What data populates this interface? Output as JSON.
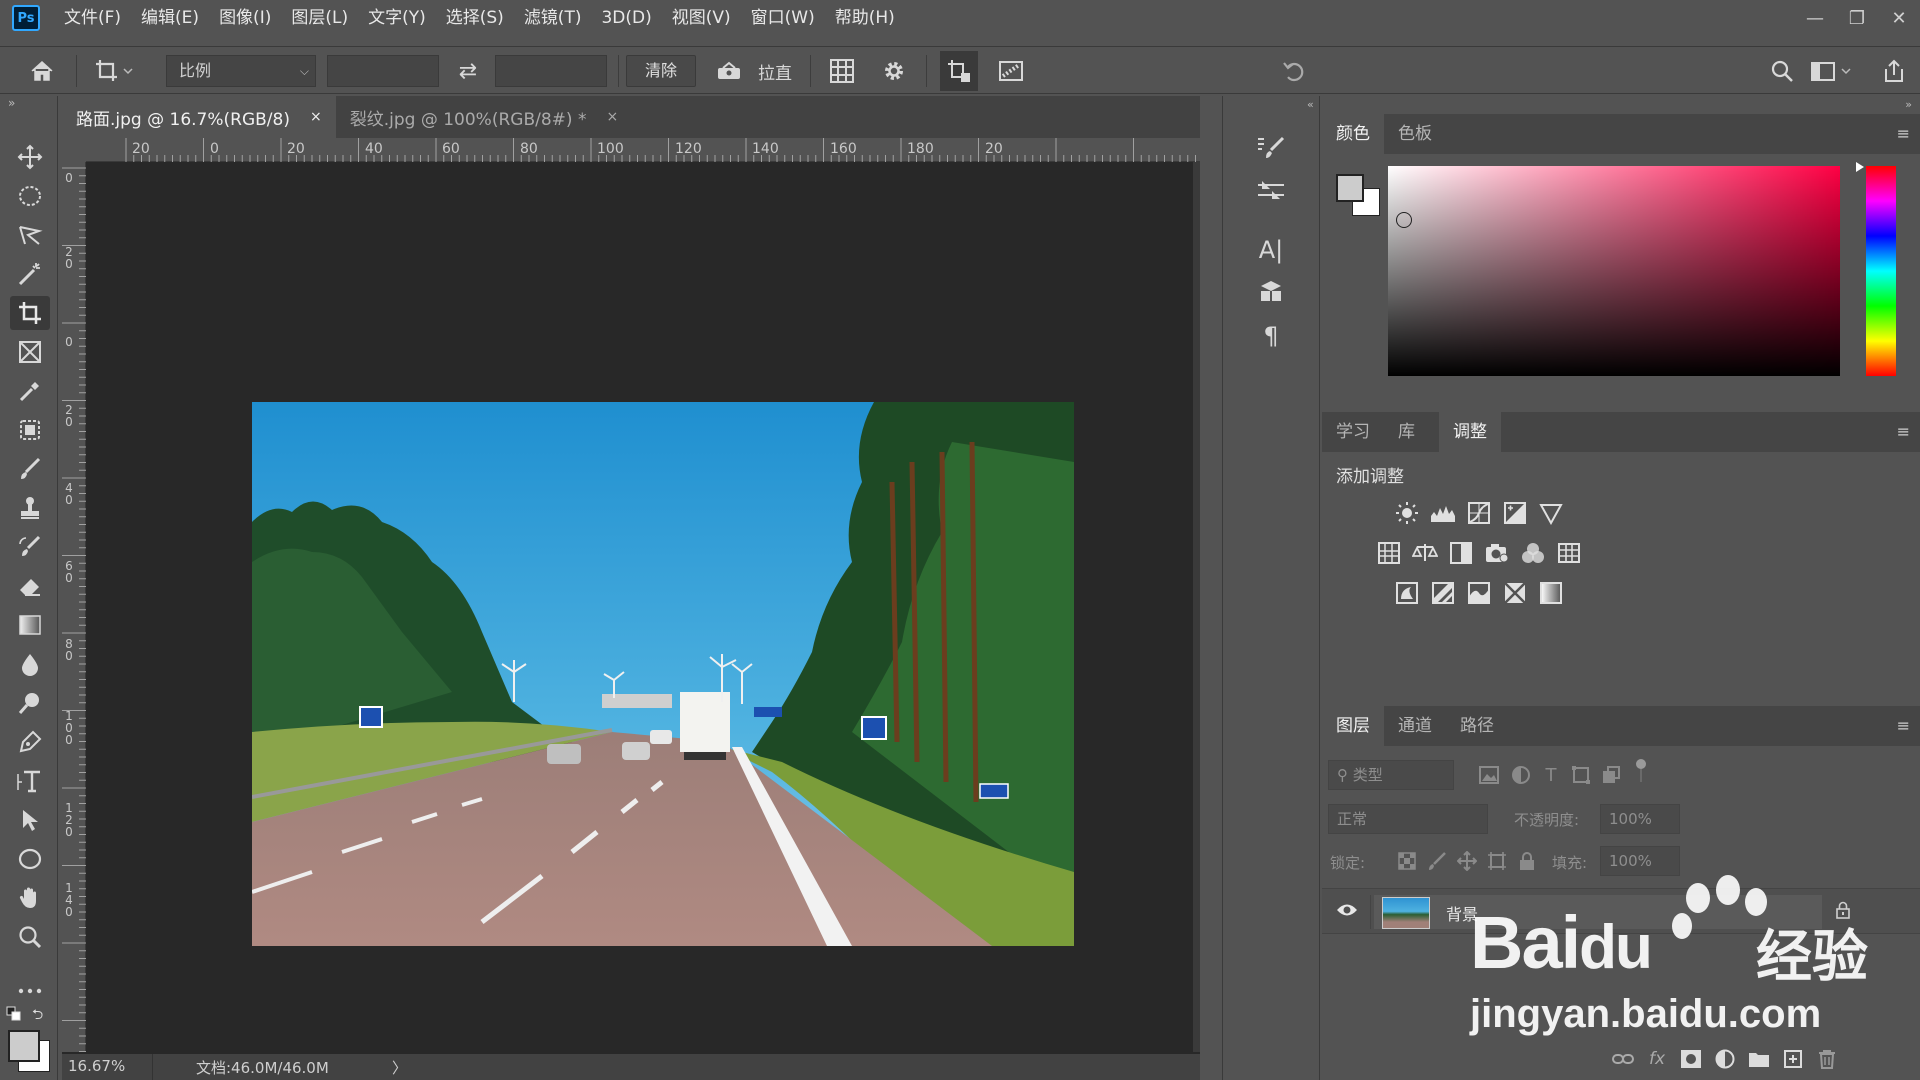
{
  "app": {
    "logo": "Ps"
  },
  "menu": [
    "文件(F)",
    "编辑(E)",
    "图像(I)",
    "图层(L)",
    "文字(Y)",
    "选择(S)",
    "滤镜(T)",
    "3D(D)",
    "视图(V)",
    "窗口(W)",
    "帮助(H)"
  ],
  "window_controls": {
    "minimize": "—",
    "restore": "❐",
    "close": "✕"
  },
  "options": {
    "ratio_value": "比例",
    "clear_label": "清除",
    "straighten_label": "拉直",
    "swap_glyph": "⇄"
  },
  "tabs": [
    {
      "label": "路面.jpg @ 16.7%(RGB/8)",
      "close": "×"
    },
    {
      "label": "裂纹.jpg @ 100%(RGB/8#) *",
      "close": "×"
    }
  ],
  "ruler": {
    "h_labels": [
      "20",
      "0",
      "20",
      "40",
      "60",
      "80",
      "100",
      "120",
      "140",
      "160",
      "180",
      "20"
    ],
    "v_labels": [
      "0",
      "2\n0",
      "0",
      "2\n0",
      "4\n0",
      "6\n0",
      "8\n0",
      "1\n0\n0",
      "1\n2\n0",
      "1\n4\n0"
    ]
  },
  "status": {
    "zoom": "16.67%",
    "doc": "文档:46.0M/46.0M",
    "arrow": "〉"
  },
  "color_panel": {
    "tabs": [
      "颜色",
      "色板"
    ],
    "fg_color": "#cccccc",
    "bg_color": "#ffffff",
    "hue_color": "#ff0044"
  },
  "adjust_panel": {
    "tabs": [
      "学习",
      "库",
      "调整"
    ],
    "title": "添加调整"
  },
  "layers_panel": {
    "tabs": [
      "图层",
      "通道",
      "路径"
    ],
    "filter_placeholder": "类型",
    "blend_mode": "正常",
    "opacity_label": "不透明度:",
    "opacity_value": "100%",
    "lock_label": "锁定:",
    "fill_label": "填充:",
    "fill_value": "100%",
    "layers": [
      {
        "name": "背景",
        "visible": true,
        "locked": true
      }
    ],
    "footer_fx": "fx"
  },
  "watermark": {
    "brand": "Bai",
    "brand2": "du",
    "cn": "经验",
    "url": "jingyan.baidu.com"
  }
}
